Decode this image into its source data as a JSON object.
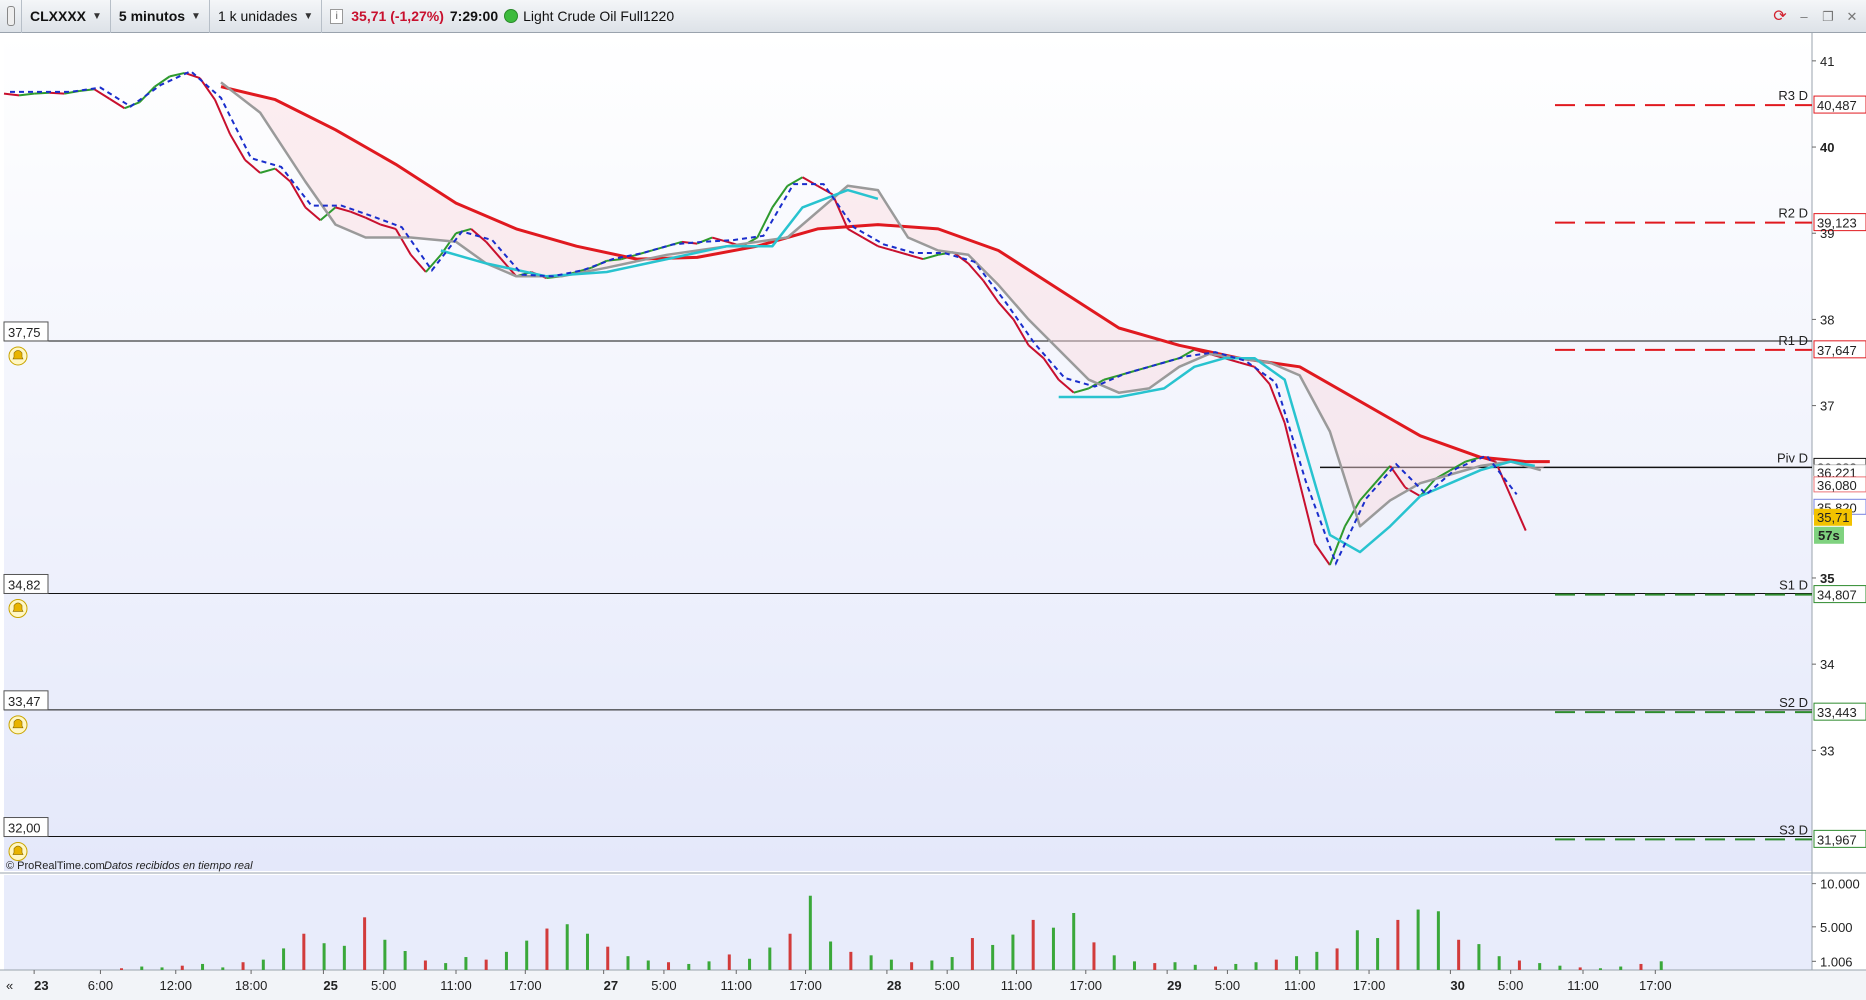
{
  "toolbar": {
    "symbol": "CLXXXX",
    "timeframe": "5 minutos",
    "units": "1 k unidades",
    "price_change": "35,71 (-1,27%)",
    "time": "7:29:00",
    "instrument": "Light Crude Oil Full1220"
  },
  "colors": {
    "price_line": "#c8102e",
    "ma_red": "#e0191f",
    "ma_gray": "#9a9a9a",
    "ma_cyan": "#28c3cf",
    "dashed_blue": "#1a2ecc",
    "cloud_cyan": "#b8eef7",
    "cloud_pink": "#fbd9de",
    "resistance": "#e0191f",
    "support": "#2e8b2e",
    "volume_up": "#3aa83a",
    "volume_down": "#d23b3b",
    "last_price_bg": "#f2c200",
    "timer_bg": "#7fd27f"
  },
  "chart_data": {
    "type": "line",
    "symbol": "CLXXXX",
    "y_ticks": [
      "41",
      "40",
      "39",
      "38",
      "37",
      "35",
      "34",
      "33"
    ],
    "y_tick_values": [
      41,
      40,
      39,
      38,
      37,
      35,
      34,
      33
    ],
    "ylim": [
      31.6,
      41.3
    ],
    "x_ticks": [
      "23",
      "6:00",
      "12:00",
      "18:00",
      "25",
      "5:00",
      "11:00",
      "17:00",
      "27",
      "5:00",
      "11:00",
      "17:00",
      "28",
      "5:00",
      "11:00",
      "17:00",
      "29",
      "5:00",
      "11:00",
      "17:00",
      "30",
      "5:00",
      "11:00",
      "17:00"
    ],
    "x_tick_bold": [
      true,
      false,
      false,
      false,
      true,
      false,
      false,
      false,
      true,
      false,
      false,
      false,
      true,
      false,
      false,
      false,
      true,
      false,
      false,
      false,
      true,
      false,
      false,
      false
    ],
    "price_path": [
      [
        0,
        40.62
      ],
      [
        0.5,
        40.6
      ],
      [
        1,
        40.62
      ],
      [
        1.5,
        40.63
      ],
      [
        2,
        40.62
      ],
      [
        2.5,
        40.65
      ],
      [
        3,
        40.67
      ],
      [
        3.5,
        40.56
      ],
      [
        4,
        40.45
      ],
      [
        4.5,
        40.52
      ],
      [
        5,
        40.7
      ],
      [
        5.5,
        40.82
      ],
      [
        6,
        40.86
      ],
      [
        6.5,
        40.8
      ],
      [
        7,
        40.55
      ],
      [
        7.5,
        40.15
      ],
      [
        8,
        39.85
      ],
      [
        8.5,
        39.7
      ],
      [
        9,
        39.75
      ],
      [
        9.5,
        39.6
      ],
      [
        10,
        39.3
      ],
      [
        10.5,
        39.15
      ],
      [
        11,
        39.3
      ],
      [
        11.5,
        39.25
      ],
      [
        12,
        39.18
      ],
      [
        12.5,
        39.1
      ],
      [
        13,
        39.05
      ],
      [
        13.5,
        38.75
      ],
      [
        14,
        38.55
      ],
      [
        14.5,
        38.75
      ],
      [
        15,
        39.0
      ],
      [
        15.5,
        39.05
      ],
      [
        16,
        38.9
      ],
      [
        16.5,
        38.7
      ],
      [
        17,
        38.5
      ],
      [
        17.5,
        38.55
      ],
      [
        18,
        38.48
      ],
      [
        18.5,
        38.5
      ],
      [
        19,
        38.55
      ],
      [
        19.5,
        38.6
      ],
      [
        20,
        38.68
      ],
      [
        20.5,
        38.7
      ],
      [
        21,
        38.75
      ],
      [
        21.5,
        38.8
      ],
      [
        22,
        38.85
      ],
      [
        22.5,
        38.9
      ],
      [
        23,
        38.88
      ],
      [
        23.5,
        38.95
      ],
      [
        24,
        38.9
      ],
      [
        24.5,
        38.85
      ],
      [
        25,
        38.95
      ],
      [
        25.5,
        39.3
      ],
      [
        26,
        39.55
      ],
      [
        26.5,
        39.65
      ],
      [
        27,
        39.55
      ],
      [
        27.5,
        39.45
      ],
      [
        28,
        39.05
      ],
      [
        28.5,
        38.95
      ],
      [
        29,
        38.85
      ],
      [
        29.5,
        38.8
      ],
      [
        30,
        38.75
      ],
      [
        30.5,
        38.7
      ],
      [
        31,
        38.75
      ],
      [
        31.5,
        38.78
      ],
      [
        32,
        38.65
      ],
      [
        32.5,
        38.45
      ],
      [
        33,
        38.2
      ],
      [
        33.5,
        38.0
      ],
      [
        34,
        37.7
      ],
      [
        34.5,
        37.55
      ],
      [
        35,
        37.3
      ],
      [
        35.5,
        37.15
      ],
      [
        36,
        37.2
      ],
      [
        36.5,
        37.3
      ],
      [
        37,
        37.35
      ],
      [
        37.5,
        37.4
      ],
      [
        38,
        37.45
      ],
      [
        38.5,
        37.5
      ],
      [
        39,
        37.55
      ],
      [
        39.5,
        37.65
      ],
      [
        40,
        37.6
      ],
      [
        40.5,
        37.55
      ],
      [
        41,
        37.5
      ],
      [
        41.5,
        37.45
      ],
      [
        42,
        37.25
      ],
      [
        42.5,
        36.8
      ],
      [
        43,
        36.1
      ],
      [
        43.5,
        35.4
      ],
      [
        44,
        35.15
      ],
      [
        44.5,
        35.6
      ],
      [
        45,
        35.9
      ],
      [
        45.5,
        36.1
      ],
      [
        46,
        36.3
      ],
      [
        46.5,
        36.05
      ],
      [
        47,
        35.95
      ],
      [
        47.5,
        36.15
      ],
      [
        48,
        36.25
      ],
      [
        48.5,
        36.35
      ],
      [
        49,
        36.4
      ],
      [
        49.5,
        36.35
      ],
      [
        50,
        35.95
      ],
      [
        50.5,
        35.55
      ]
    ],
    "x_range": [
      0,
      60
    ],
    "x_tick_positions": [
      1,
      3.2,
      5.7,
      8.2,
      10.6,
      12.6,
      15.0,
      17.3,
      19.9,
      21.9,
      24.3,
      26.6,
      29.3,
      31.3,
      33.6,
      35.9,
      38.6,
      40.6,
      43.0,
      45.3,
      48.0,
      50.0,
      52.4,
      54.8
    ],
    "moving_averages": [
      {
        "color": "#e0191f",
        "points": [
          [
            7.2,
            40.7
          ],
          [
            9,
            40.55
          ],
          [
            11,
            40.2
          ],
          [
            13,
            39.8
          ],
          [
            15,
            39.35
          ],
          [
            17,
            39.05
          ],
          [
            19,
            38.85
          ],
          [
            21,
            38.7
          ],
          [
            23,
            38.72
          ],
          [
            25,
            38.85
          ],
          [
            27,
            39.05
          ],
          [
            29,
            39.1
          ],
          [
            31,
            39.05
          ],
          [
            33,
            38.8
          ],
          [
            35,
            38.35
          ],
          [
            37,
            37.9
          ],
          [
            39,
            37.7
          ],
          [
            41,
            37.55
          ],
          [
            43,
            37.45
          ],
          [
            45,
            37.05
          ],
          [
            47,
            36.65
          ],
          [
            49,
            36.4
          ],
          [
            50.5,
            36.35
          ],
          [
            51.3,
            36.35
          ]
        ]
      },
      {
        "color": "#9a9a9a",
        "points": [
          [
            7.2,
            40.75
          ],
          [
            8.5,
            40.4
          ],
          [
            10,
            39.6
          ],
          [
            11,
            39.1
          ],
          [
            12,
            38.95
          ],
          [
            13.5,
            38.95
          ],
          [
            15,
            38.9
          ],
          [
            16,
            38.65
          ],
          [
            17,
            38.5
          ],
          [
            18.5,
            38.5
          ],
          [
            20,
            38.6
          ],
          [
            22,
            38.75
          ],
          [
            24,
            38.85
          ],
          [
            26,
            38.95
          ],
          [
            28,
            39.55
          ],
          [
            29,
            39.5
          ],
          [
            30,
            38.95
          ],
          [
            31,
            38.8
          ],
          [
            32,
            38.75
          ],
          [
            33,
            38.4
          ],
          [
            34,
            38.0
          ],
          [
            35,
            37.65
          ],
          [
            36,
            37.3
          ],
          [
            37,
            37.15
          ],
          [
            38,
            37.2
          ],
          [
            39,
            37.45
          ],
          [
            40,
            37.6
          ],
          [
            41,
            37.55
          ],
          [
            42,
            37.5
          ],
          [
            43,
            37.35
          ],
          [
            44,
            36.7
          ],
          [
            45,
            35.6
          ],
          [
            46,
            35.9
          ],
          [
            47,
            36.1
          ],
          [
            48,
            36.2
          ],
          [
            49,
            36.3
          ],
          [
            50,
            36.35
          ],
          [
            51,
            36.25
          ]
        ]
      },
      {
        "color": "#28c3cf",
        "points": [
          [
            14.5,
            38.8
          ],
          [
            16,
            38.65
          ],
          [
            18,
            38.5
          ],
          [
            20,
            38.55
          ],
          [
            22,
            38.7
          ],
          [
            24,
            38.85
          ],
          [
            25.5,
            38.85
          ],
          [
            26.5,
            39.3
          ],
          [
            28,
            39.5
          ],
          [
            29,
            39.4
          ]
        ]
      },
      {
        "color": "#28c3cf",
        "points": [
          [
            35,
            37.1
          ],
          [
            37,
            37.1
          ],
          [
            38.5,
            37.2
          ],
          [
            39.5,
            37.45
          ],
          [
            40.5,
            37.55
          ],
          [
            41.5,
            37.55
          ],
          [
            42.5,
            37.3
          ],
          [
            44,
            35.5
          ],
          [
            45,
            35.3
          ],
          [
            46,
            35.6
          ],
          [
            47,
            35.95
          ],
          [
            48,
            36.1
          ],
          [
            49,
            36.25
          ],
          [
            50,
            36.35
          ],
          [
            50.8,
            36.3
          ]
        ]
      }
    ],
    "resistance_levels": [
      {
        "name": "R3 D",
        "value": 40.487,
        "label": "40,487",
        "color": "#e0191f"
      },
      {
        "name": "R2 D",
        "value": 39.123,
        "label": "39,123",
        "color": "#e0191f"
      },
      {
        "name": "R1 D",
        "value": 37.647,
        "label": "37,647",
        "color": "#e0191f"
      },
      {
        "name": "Piv D",
        "value": 36.283,
        "label": "36,283",
        "color": "#111111"
      },
      {
        "name": "S1 D",
        "value": 34.807,
        "label": "34,807",
        "color": "#2e8b2e"
      },
      {
        "name": "S2 D",
        "value": 33.443,
        "label": "33,443",
        "color": "#2e8b2e"
      },
      {
        "name": "S3 D",
        "value": 31.967,
        "label": "31,967",
        "color": "#2e8b2e"
      }
    ],
    "pivot_extra_labels": [
      {
        "value": 36.221,
        "label": "36,221",
        "color": "#999999"
      },
      {
        "value": 36.08,
        "label": "36,080",
        "color": "#e0191f"
      },
      {
        "value": 35.82,
        "label": "35,820",
        "color": "#1a2ecc"
      }
    ],
    "alert_lines": [
      {
        "value": 37.75,
        "label": "37,75"
      },
      {
        "value": 34.82,
        "label": "34,82"
      },
      {
        "value": 33.47,
        "label": "33,47"
      },
      {
        "value": 32.0,
        "label": "32,00"
      }
    ],
    "last_price": {
      "value": 35.71,
      "label": "35,71"
    },
    "timer": "57s",
    "volume": {
      "y_ticks": [
        "10.000",
        "5.000",
        "1.006"
      ],
      "y_tick_values": [
        10000,
        5000,
        1006
      ],
      "ylim": [
        0,
        11000
      ],
      "bars": [
        200,
        400,
        300,
        500,
        700,
        300,
        900,
        1200,
        2500,
        4200,
        3100,
        2800,
        6100,
        3500,
        2200,
        1100,
        800,
        1500,
        1200,
        2100,
        3400,
        4800,
        5300,
        4200,
        2700,
        1600,
        1100,
        900,
        700,
        1000,
        1800,
        1300,
        2600,
        4200,
        8600,
        3300,
        2100,
        1700,
        1200,
        900,
        1100,
        1500,
        3700,
        2900,
        4100,
        5800,
        4900,
        6600,
        3200,
        1700,
        1000,
        800,
        900,
        600,
        400,
        700,
        900,
        1200,
        1600,
        2100,
        2500,
        4600,
        3700,
        5800,
        7000,
        6800,
        3500,
        3000,
        1600,
        1100,
        800,
        500,
        300,
        200,
        400,
        700,
        1006
      ],
      "up_color": "#3aa83a",
      "down_color": "#d23b3b"
    },
    "watermark": "© ProRealTime.com",
    "watermark_note": "Datos recibidos en tiempo real"
  }
}
